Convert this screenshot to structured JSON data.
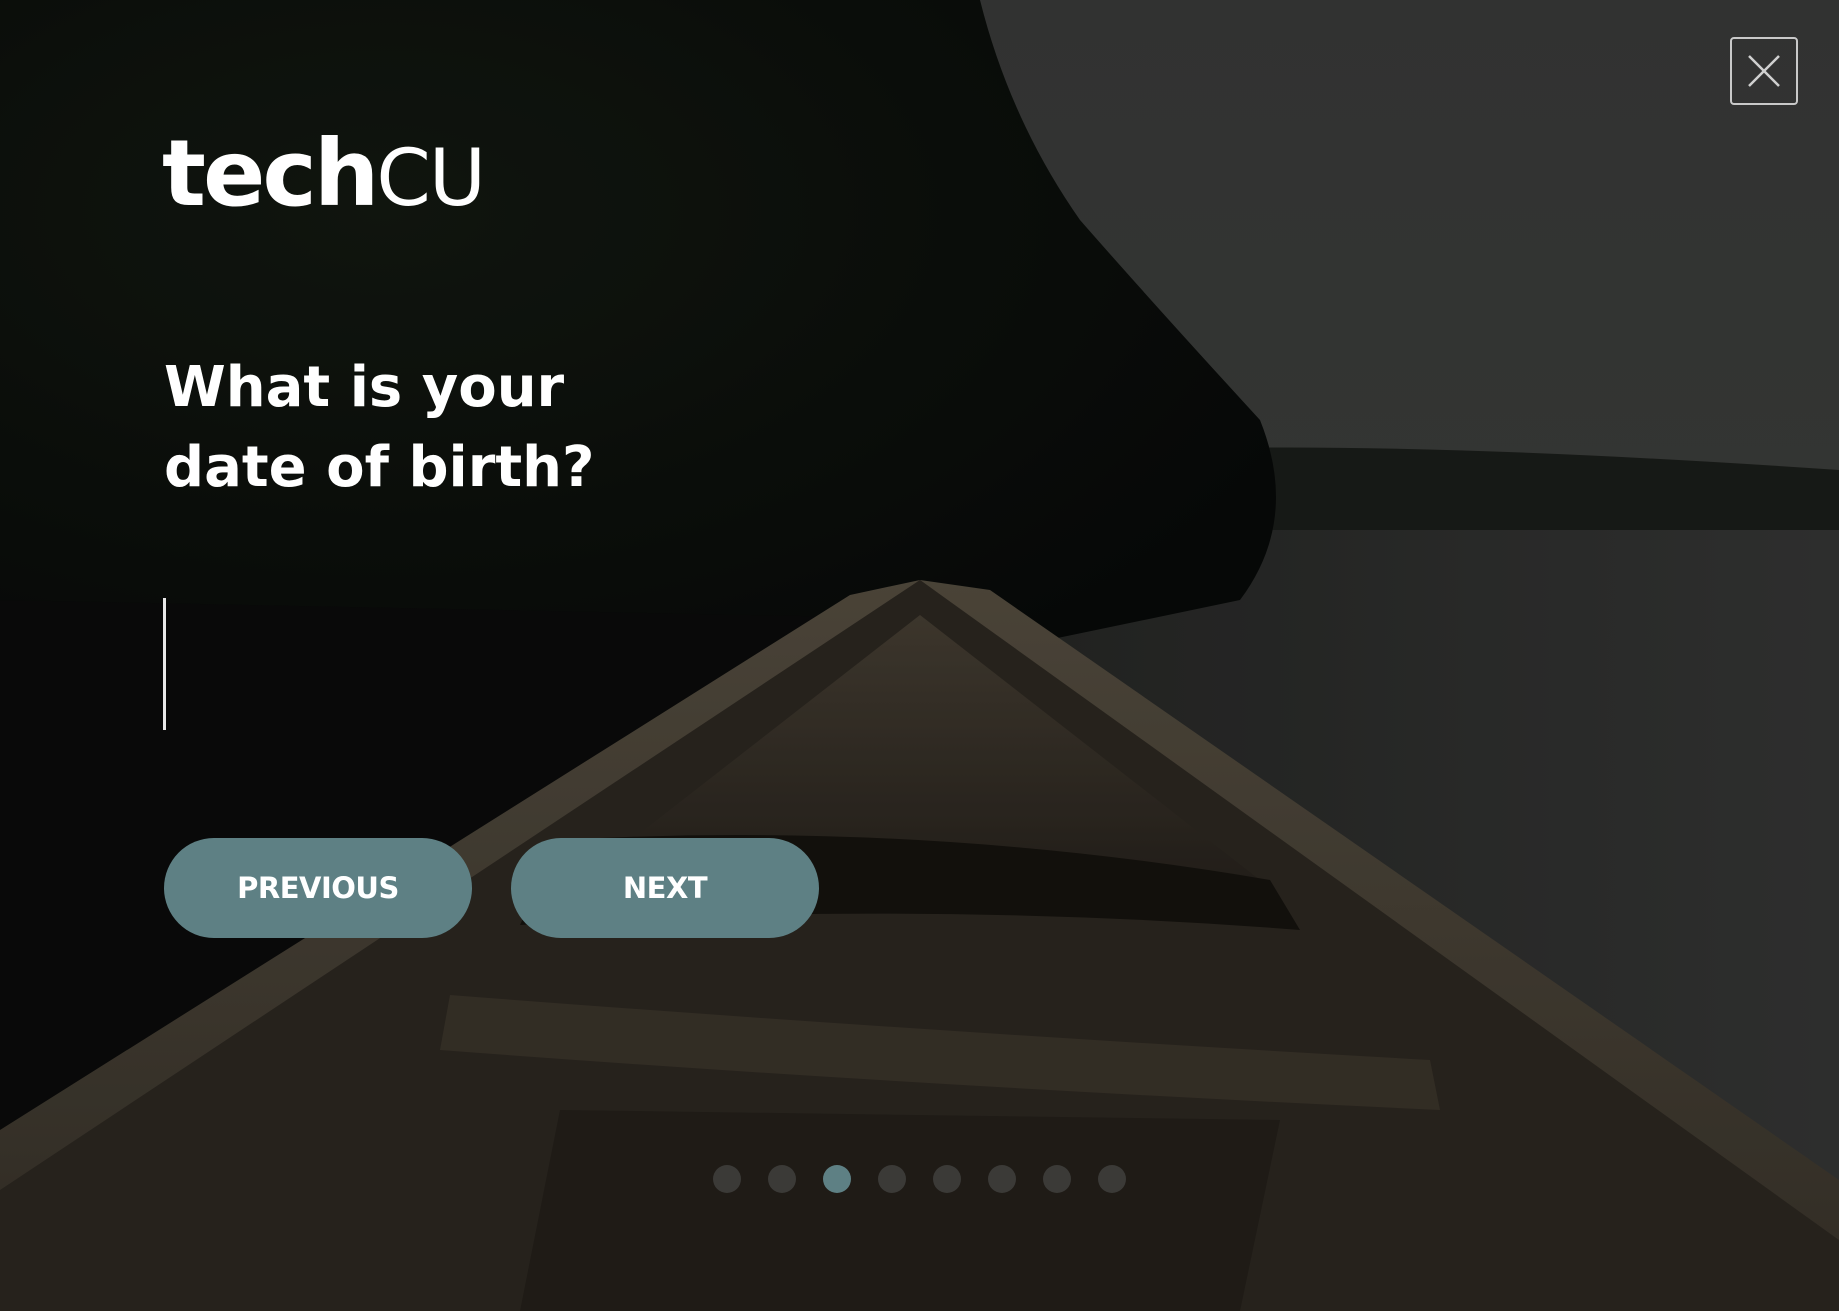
{
  "brand": {
    "logo_bold": "tech",
    "logo_light": "CU",
    "logo_alt": "techCU"
  },
  "question": {
    "line1": "What is your",
    "line2": "date of birth?"
  },
  "dob_input": {
    "value": "",
    "placeholder": ""
  },
  "buttons": {
    "previous_label": "PREVIOUS",
    "next_label": "NEXT",
    "close_label": "Close"
  },
  "progress": {
    "total_steps": 8,
    "current_step": 3
  },
  "colors": {
    "accent": "#5e8084",
    "text": "#ffffff",
    "dot_inactive": "#3b3a37"
  },
  "background": {
    "description_icon": "canoe-on-lake-photo"
  }
}
